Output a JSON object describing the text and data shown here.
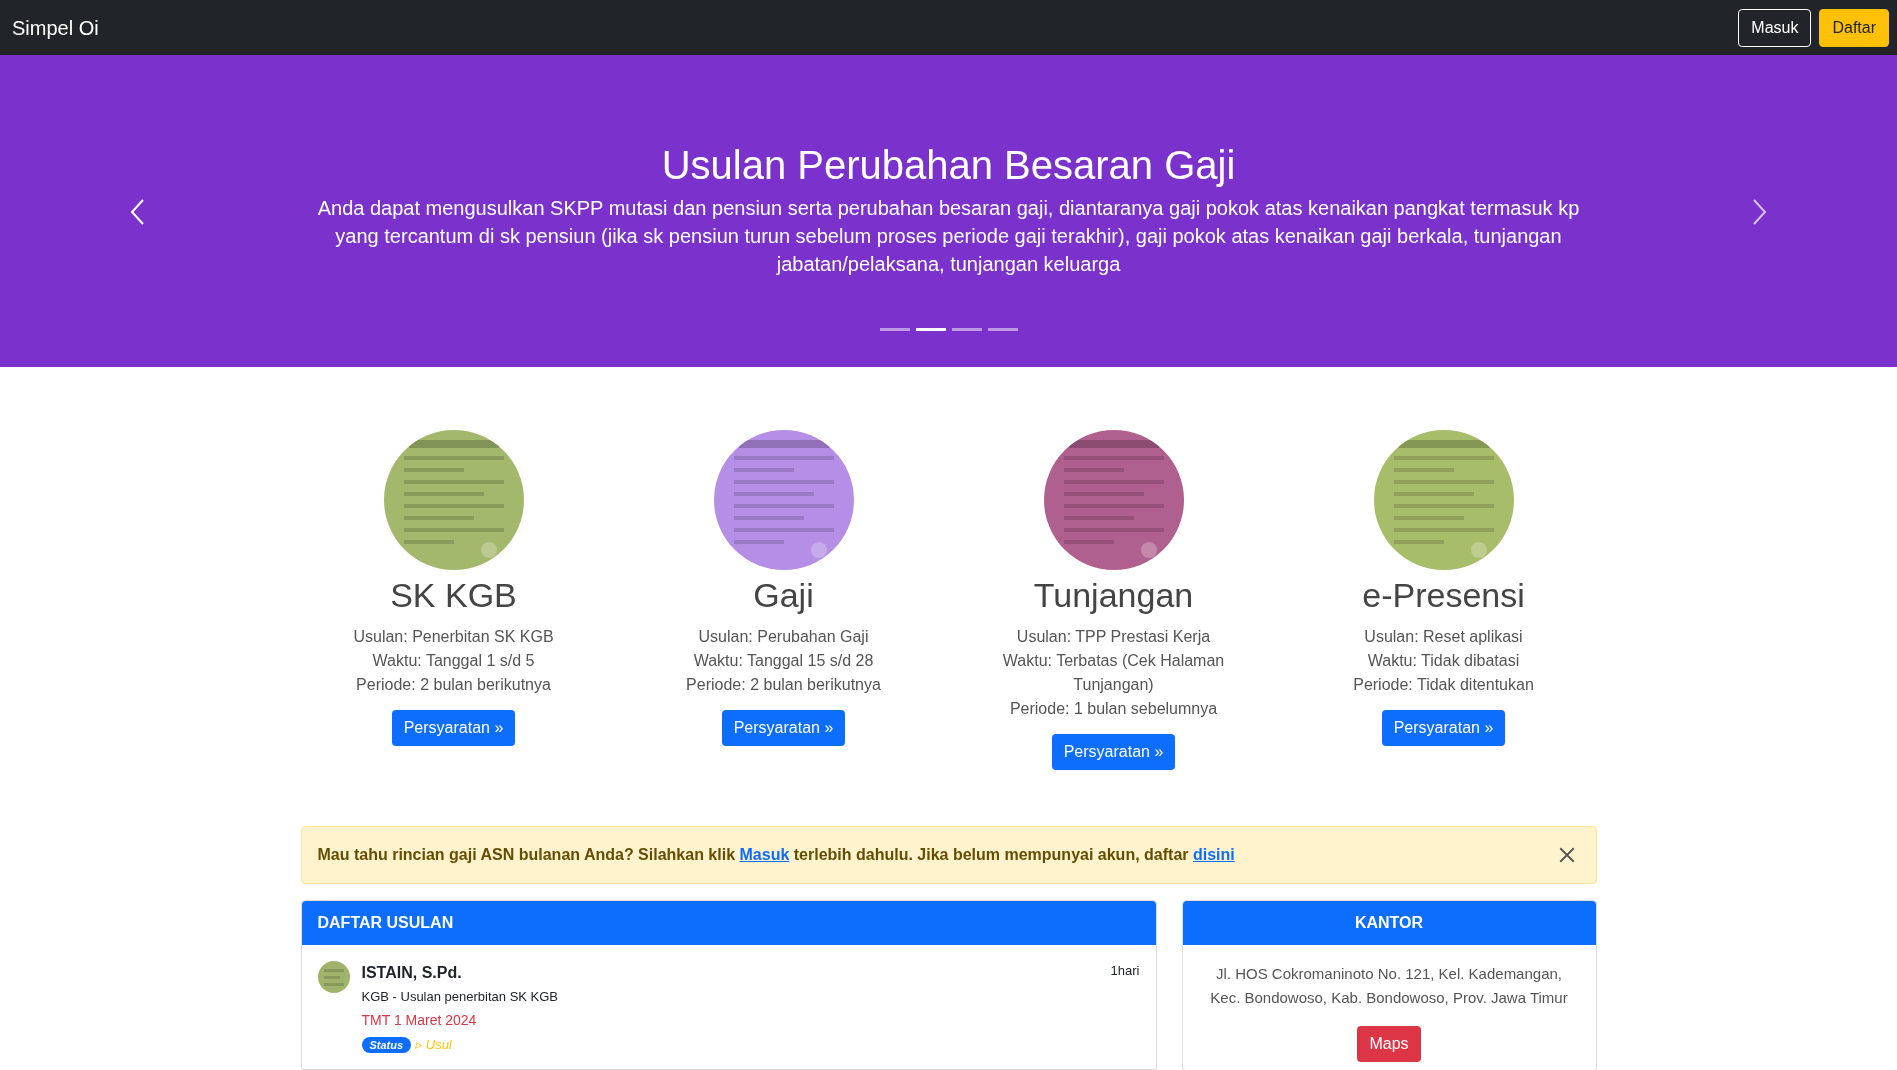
{
  "navbar": {
    "brand": "Simpel Oi",
    "buttons": [
      {
        "label": "Masuk",
        "kind": "outline"
      },
      {
        "label": "Daftar",
        "kind": "warning"
      }
    ]
  },
  "carousel": {
    "title": "Usulan Perubahan Besaran Gaji",
    "text": "Anda dapat mengusulkan SKPP mutasi dan pensiun serta perubahan besaran gaji, diantaranya gaji pokok atas kenaikan pangkat termasuk kp yang tercantum di sk pensiun (jika sk pensiun turun sebelum proses periode gaji terakhir), gaji pokok atas kenaikan gaji berkala, tunjangan jabatan/pelaksana, tunjangan keluarga",
    "indicators": [
      {
        "selected": false
      },
      {
        "selected": true
      },
      {
        "selected": false
      },
      {
        "selected": false
      }
    ]
  },
  "services": [
    {
      "title": "SK KGB",
      "lines": [
        "Usulan: Penerbitan SK KGB",
        "Waktu: Tanggal 1 s/d 5",
        "Periode: 2 bulan berikutnya"
      ],
      "button": "Persyaratan »"
    },
    {
      "title": "Gaji",
      "lines": [
        "Usulan: Perubahan Gaji",
        "Waktu: Tanggal 15 s/d 28",
        "Periode: 2 bulan berikutnya"
      ],
      "button": "Persyaratan »"
    },
    {
      "title": "Tunjangan",
      "lines": [
        "Usulan: TPP Prestasi Kerja",
        "Waktu: Terbatas (Cek Halaman Tunjangan)",
        "Periode: 1 bulan sebelumnya"
      ],
      "button": "Persyaratan »"
    },
    {
      "title": "e-Presensi",
      "lines": [
        "Usulan: Reset aplikasi",
        "Waktu: Tidak dibatasi",
        "Periode: Tidak ditentukan"
      ],
      "button": "Persyaratan »"
    }
  ],
  "alert": {
    "segments": [
      {
        "kind": "text",
        "text": "Mau tahu rincian gaji ASN bulanan Anda? Silahkan klik "
      },
      {
        "kind": "link",
        "text": "Masuk"
      },
      {
        "kind": "text",
        "text": " terlebih dahulu. Jika belum mempunyai akun, daftar "
      },
      {
        "kind": "link",
        "text": "disini"
      }
    ]
  },
  "daftar_usulan": {
    "title": "DAFTAR USULAN",
    "items": [
      {
        "name": "ISTAIN, S.Pd.",
        "detail": "KGB - Usulan penerbitan SK KGB",
        "tmt": "TMT 1 Maret 2024",
        "status_label": "Status",
        "status": "▹ Usul",
        "time": "1hari"
      }
    ]
  },
  "kantor": {
    "title": "KANTOR",
    "address": "Jl. HOS Cokromaninoto No. 121, Kel. Kademangan, Kec. Bondowoso, Kab. Bondowoso, Prov. Jawa Timur",
    "button": "Maps"
  }
}
